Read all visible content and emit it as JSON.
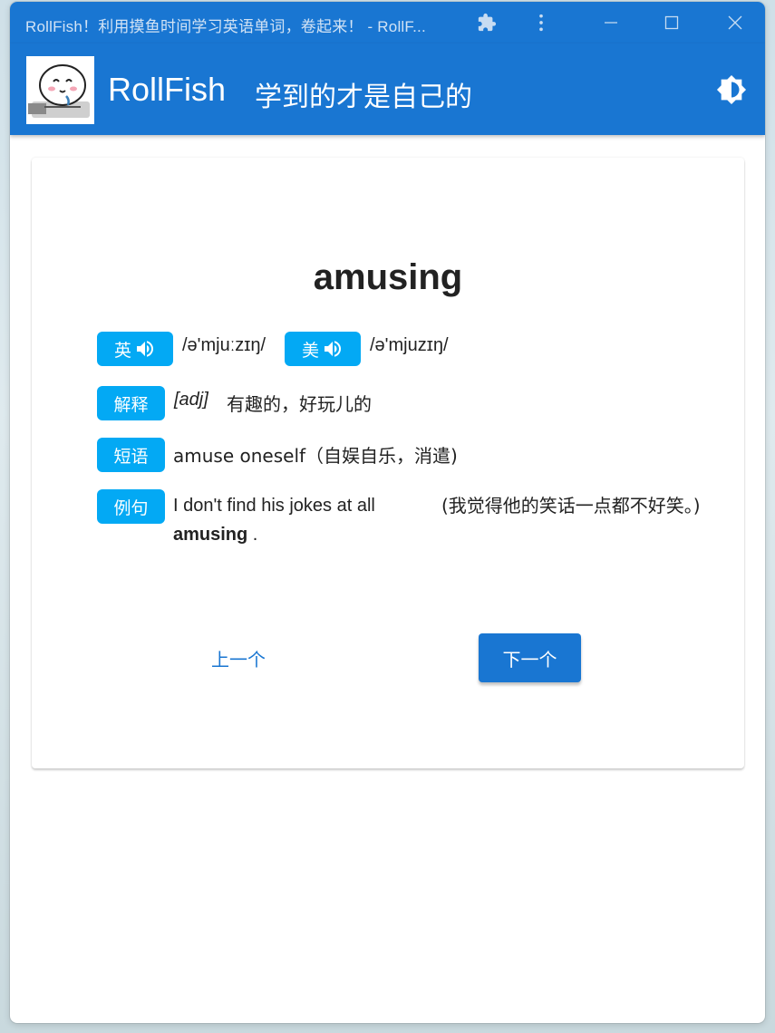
{
  "window": {
    "title": "RollFish！利用摸鱼时间学习英语单词，卷起来！ - RollF..."
  },
  "appbar": {
    "name": "RollFish",
    "slogan": "学到的才是自己的",
    "theme_icon": "brightness-icon",
    "accent_color": "#1976d2"
  },
  "card": {
    "word": "amusing",
    "pronunciation": {
      "uk_label": "英",
      "uk_phonetic": "/ə'mjuːzɪŋ/",
      "us_label": "美",
      "us_phonetic": "/ə'mjuzɪŋ/"
    },
    "definition": {
      "label": "解释",
      "part_of_speech": "[adj]",
      "meaning": "有趣的，好玩儿的"
    },
    "phrase": {
      "label": "短语",
      "text": "amuse oneself（自娱自乐，消遣)"
    },
    "example": {
      "label": "例句",
      "en_before": "I don't find his jokes at all",
      "en_highlight": "amusing",
      "en_after": " .",
      "cn": "(我觉得他的笑话一点都不好笑。)"
    },
    "chip_color": "#03a9f4",
    "prev_label": "上一个",
    "next_label": "下一个"
  }
}
